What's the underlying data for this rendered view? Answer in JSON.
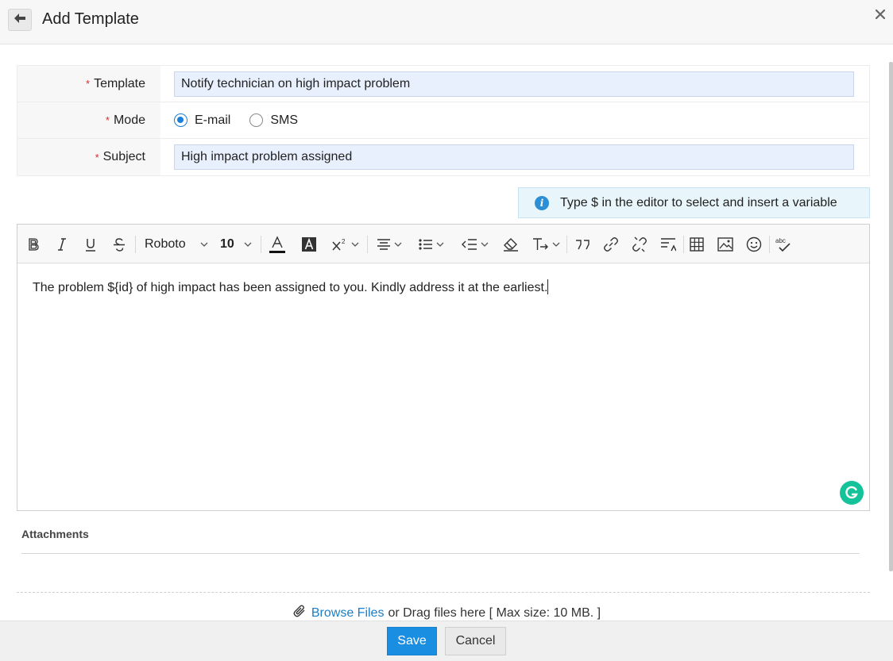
{
  "header": {
    "title": "Add Template"
  },
  "form": {
    "template_label": "Template",
    "template_value": "Notify technician on high impact problem",
    "mode_label": "Mode",
    "mode_options": [
      "E-mail",
      "SMS"
    ],
    "mode_selected": "E-mail",
    "subject_label": "Subject",
    "subject_value": "High impact problem assigned",
    "required_marker": "*"
  },
  "info": {
    "text": "Type $ in the editor to select and insert a variable",
    "icon": "info-icon"
  },
  "toolbar": {
    "font_name": "Roboto",
    "font_size": "10",
    "icons": [
      "bold-icon",
      "italic-icon",
      "underline-icon",
      "strikethrough-icon",
      "font-family-dropdown",
      "font-size-dropdown",
      "font-color-icon",
      "highlight-icon",
      "superscript-icon",
      "align-icon",
      "list-icon",
      "indent-icon",
      "clear-format-icon",
      "text-direction-icon",
      "quote-icon",
      "link-icon",
      "unlink-icon",
      "line-height-icon",
      "table-icon",
      "image-icon",
      "emoji-icon",
      "spellcheck-icon"
    ]
  },
  "editor": {
    "content": "The problem ${id} of high impact has been assigned to you. Kindly address it at the earliest."
  },
  "attachments": {
    "title": "Attachments",
    "browse_link": "Browse Files",
    "drag_text": "or Drag files here [ Max size: 10 MB. ]"
  },
  "footer": {
    "save_label": "Save",
    "cancel_label": "Cancel"
  },
  "colors": {
    "primary": "#1a8ee0",
    "input_bg": "#e8f0fe",
    "required": "#d62c2c",
    "info_bg": "#e8f5fb",
    "grammarly": "#15c39a"
  }
}
